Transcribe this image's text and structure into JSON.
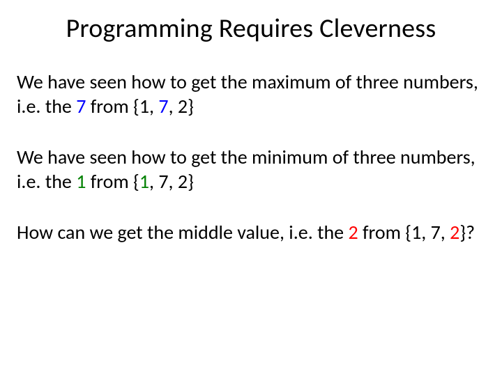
{
  "title": "Programming Requires Cleverness",
  "paragraphs": {
    "max": {
      "t1": "We have seen how to get the maximum of three numbers, i.e. the ",
      "hi1": "7",
      "t2": " from {1, ",
      "hi2": "7",
      "t3": ", 2}"
    },
    "min": {
      "t1": "We have seen how to get the minimum of three numbers, i.e. the ",
      "hi1": "1",
      "t2": " from {",
      "hi2": "1",
      "t3": ", 7, 2}"
    },
    "mid": {
      "t1": "How can we get the middle value, i.e. the ",
      "hi1": "2",
      "t2": " from {1, 7, ",
      "hi2": "2",
      "t3": "}?"
    }
  },
  "colors": {
    "max": "#0000ff",
    "min": "#008000",
    "mid": "#ff0000"
  }
}
